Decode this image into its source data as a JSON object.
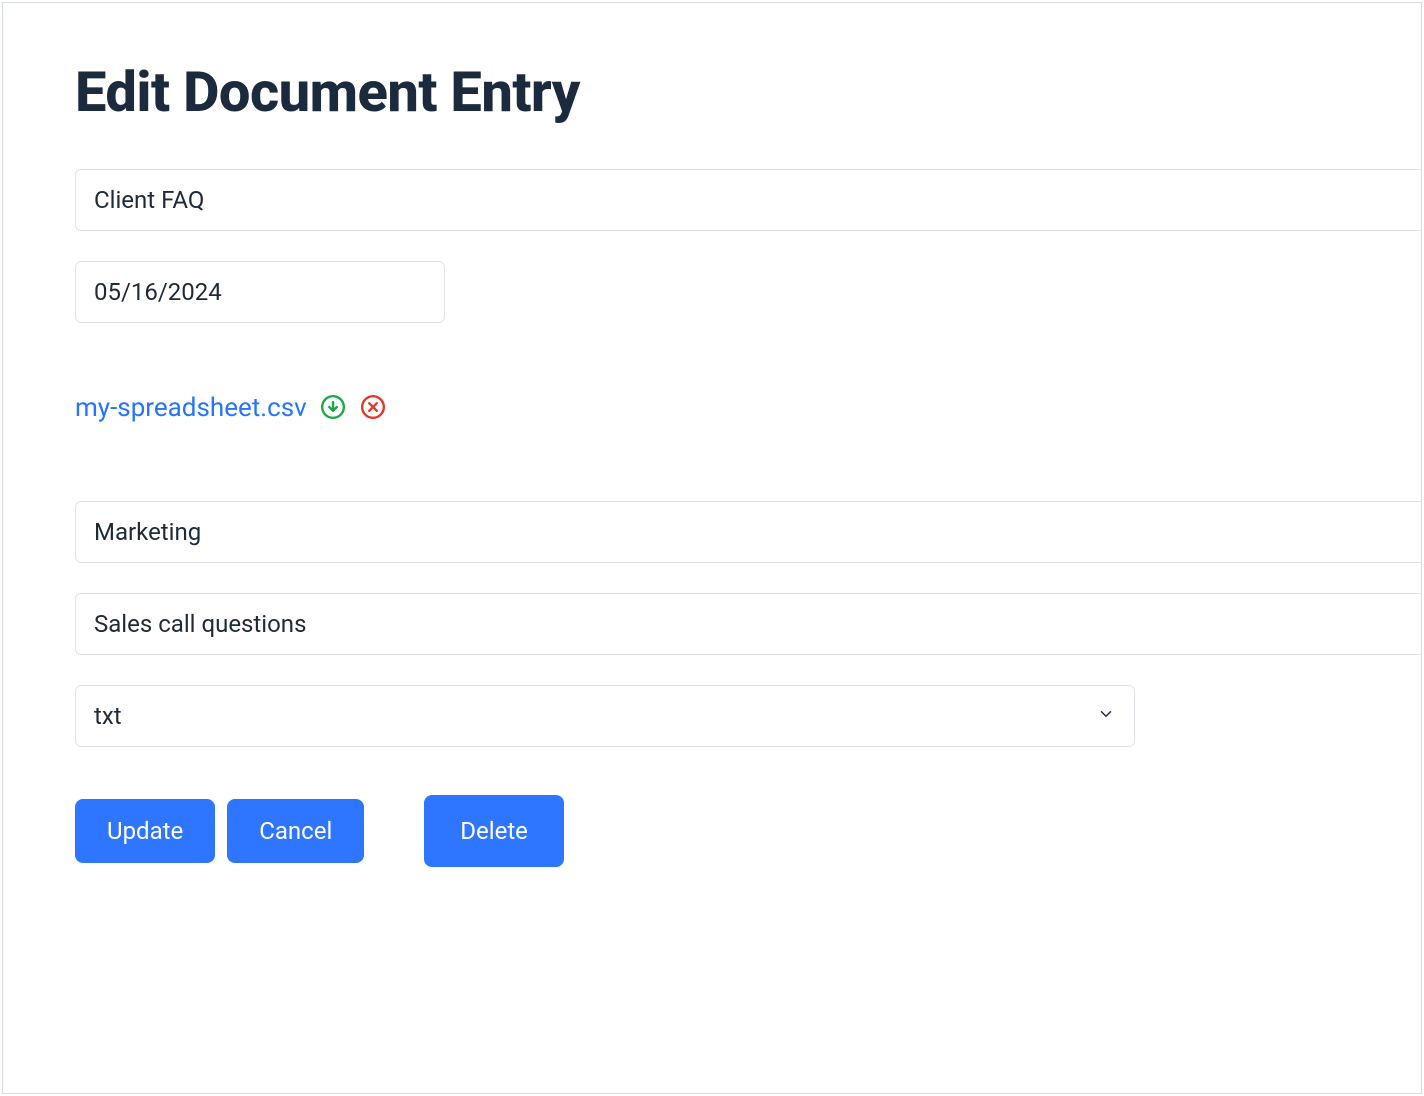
{
  "page": {
    "title": "Edit Document Entry"
  },
  "form": {
    "title_value": "Client FAQ",
    "date_value": "05/16/2024",
    "attachment_name": "my-spreadsheet.csv",
    "category_value": "Marketing",
    "description_value": "Sales call questions",
    "format_value": "txt"
  },
  "buttons": {
    "update": "Update",
    "cancel": "Cancel",
    "delete": "Delete"
  },
  "icons": {
    "download": "download-circle",
    "remove": "remove-circle",
    "chevron": "chevron-down"
  },
  "colors": {
    "primary": "#2e76ff",
    "text": "#1e2a3a",
    "link": "#2474ff",
    "border": "#dfe3e8",
    "success": "#19a945",
    "danger": "#e2382a"
  }
}
